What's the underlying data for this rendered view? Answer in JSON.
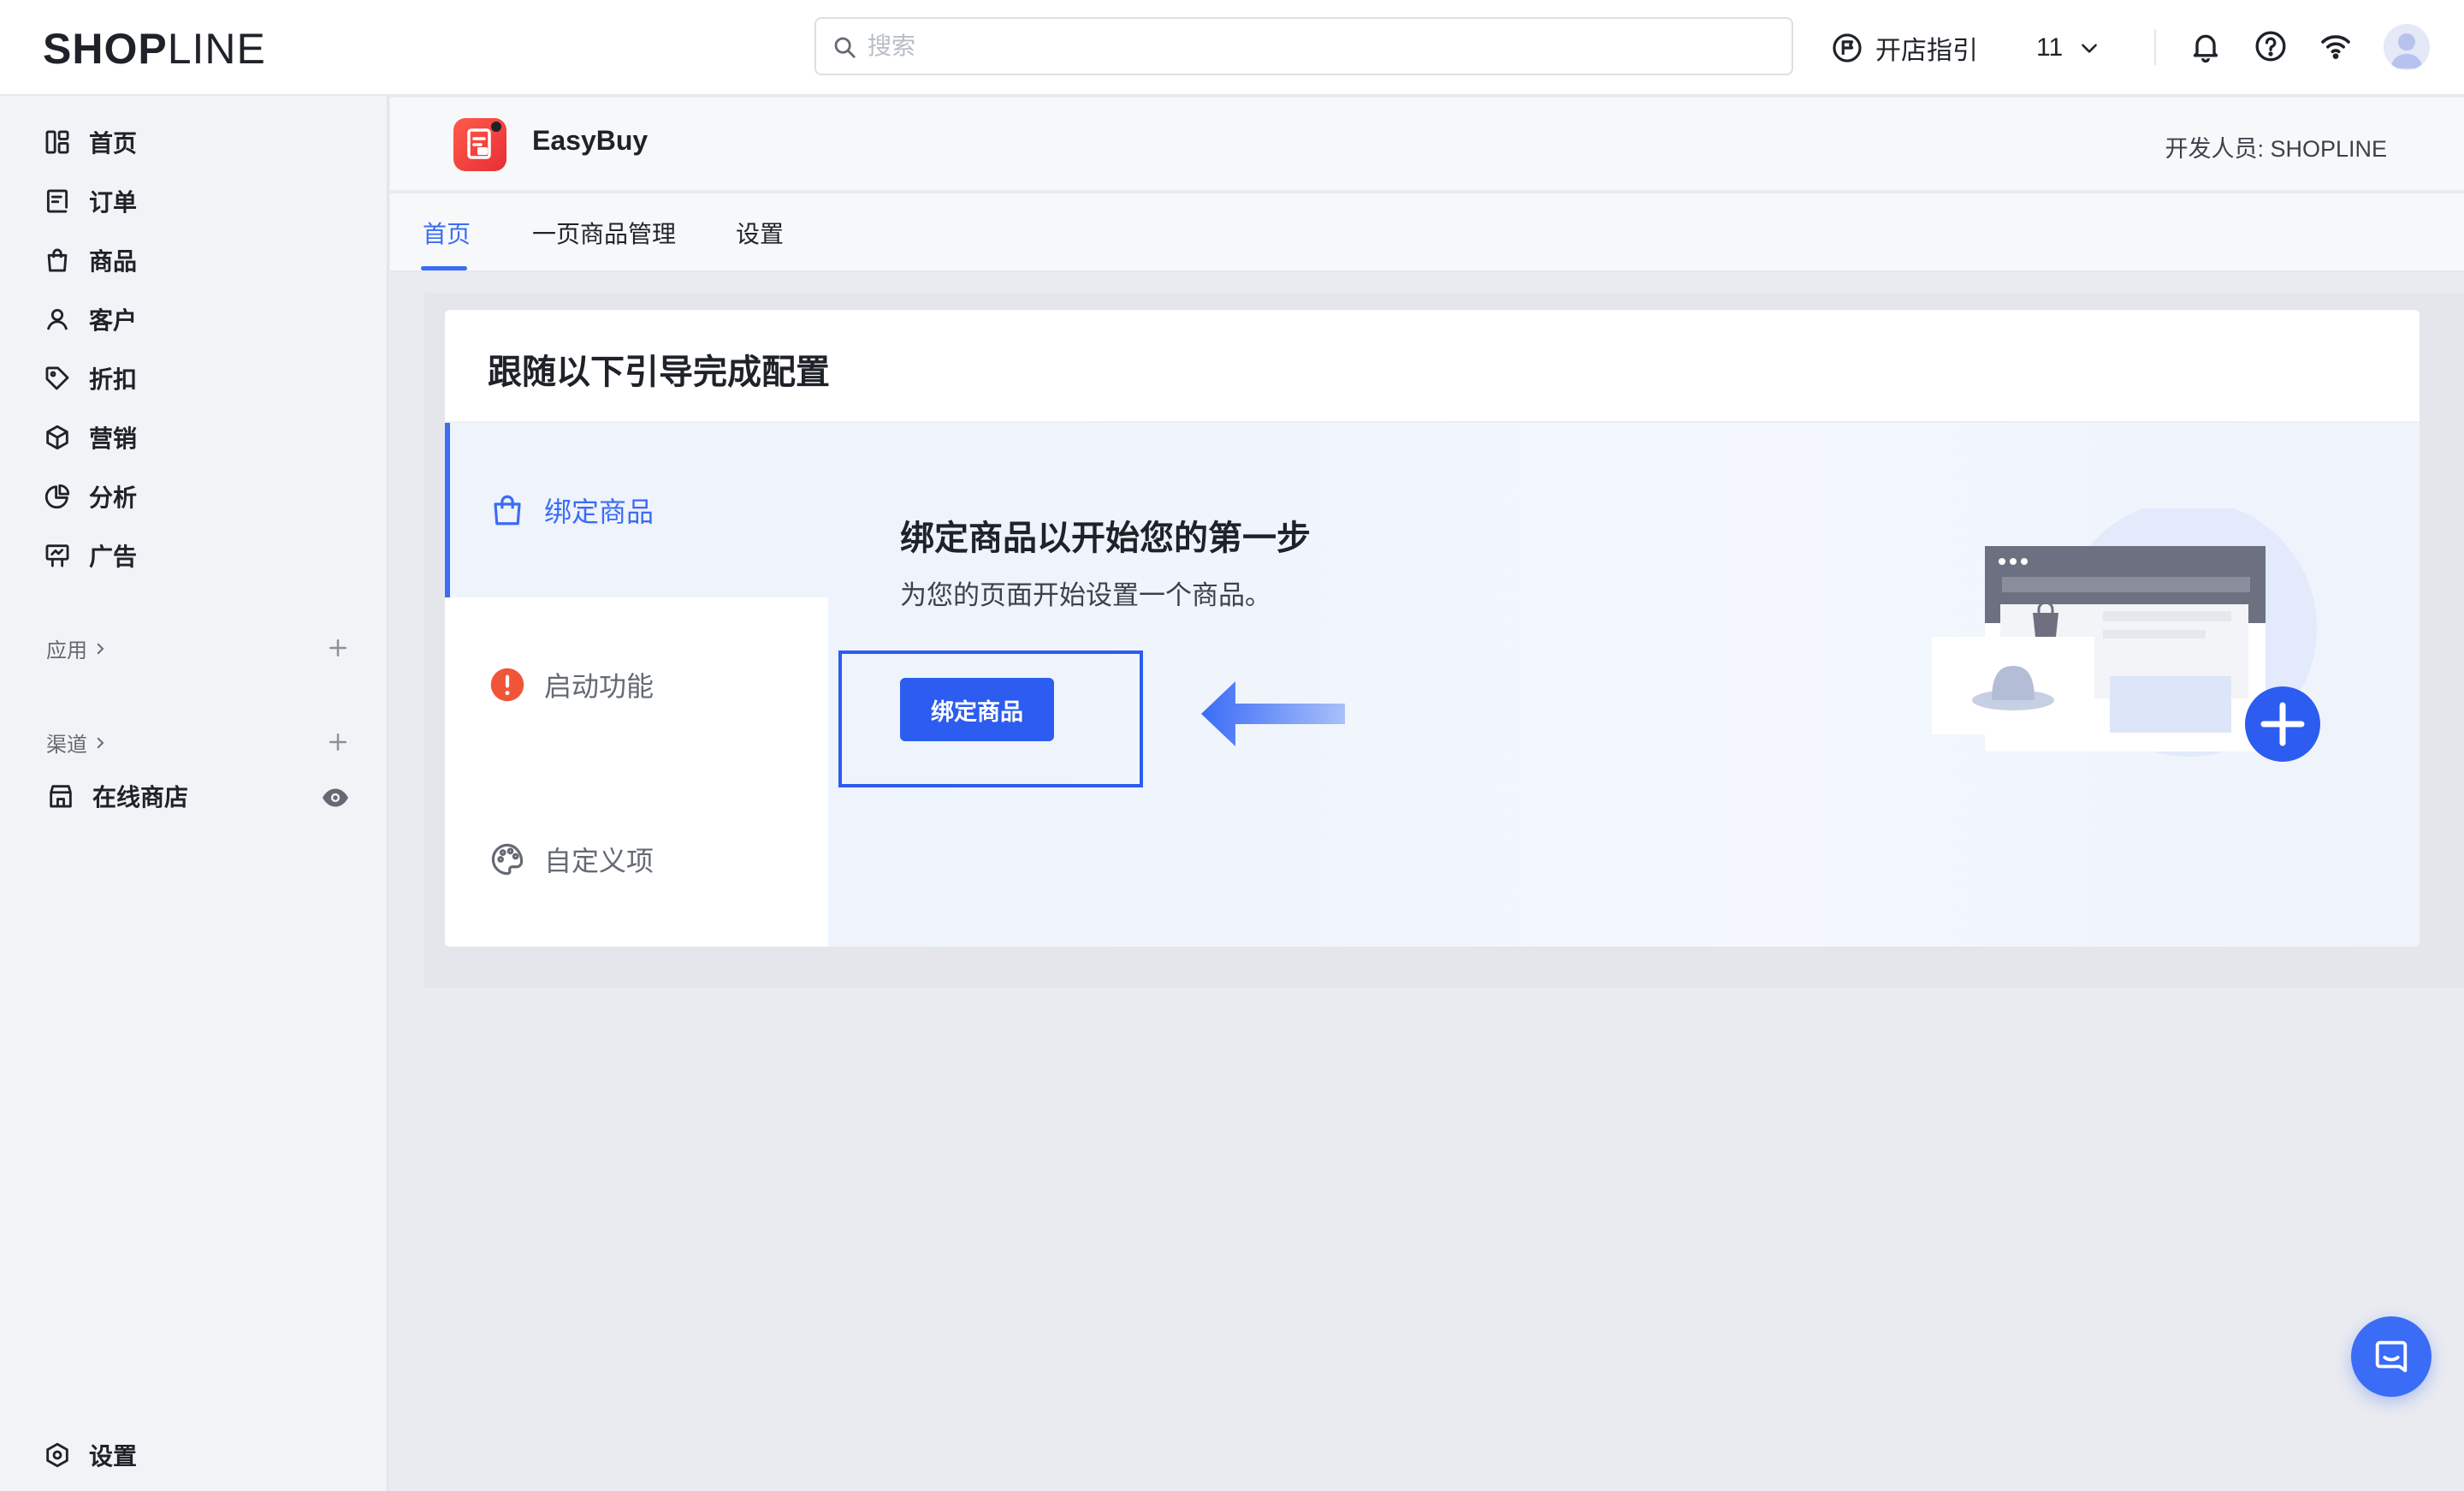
{
  "topbar": {
    "logo_bold": "SHOP",
    "logo_light": "LINE",
    "search_placeholder": "搜索",
    "guide_label": "开店指引",
    "store_selector": "11"
  },
  "sidebar": {
    "items": [
      {
        "label": "首页",
        "icon": "dashboard-icon"
      },
      {
        "label": "订单",
        "icon": "order-icon"
      },
      {
        "label": "商品",
        "icon": "bag-icon"
      },
      {
        "label": "客户",
        "icon": "user-icon"
      },
      {
        "label": "折扣",
        "icon": "tag-icon"
      },
      {
        "label": "营销",
        "icon": "cube-icon"
      },
      {
        "label": "分析",
        "icon": "pie-chart-icon"
      },
      {
        "label": "广告",
        "icon": "billboard-icon"
      }
    ],
    "apps_label": "应用",
    "channels_label": "渠道",
    "online_store_label": "在线商店",
    "settings_label": "设置"
  },
  "app": {
    "name": "EasyBuy",
    "developer": "开发人员: SHOPLINE",
    "tabs": [
      {
        "label": "首页",
        "active": true
      },
      {
        "label": "一页商品管理",
        "active": false
      },
      {
        "label": "设置",
        "active": false
      }
    ]
  },
  "guide": {
    "title": "跟随以下引导完成配置",
    "steps": [
      {
        "label": "绑定商品",
        "icon": "bag-icon",
        "active": true
      },
      {
        "label": "启动功能",
        "icon": "alert-icon",
        "active": false
      },
      {
        "label": "自定义项",
        "icon": "palette-icon",
        "active": false
      }
    ],
    "content_title": "绑定商品以开始您的第一步",
    "content_subtitle": "为您的页面开始设置一个商品。",
    "button_label": "绑定商品"
  },
  "colors": {
    "accent": "#3b6cf6",
    "button": "#2c5cf0",
    "alert": "#f0553a"
  }
}
